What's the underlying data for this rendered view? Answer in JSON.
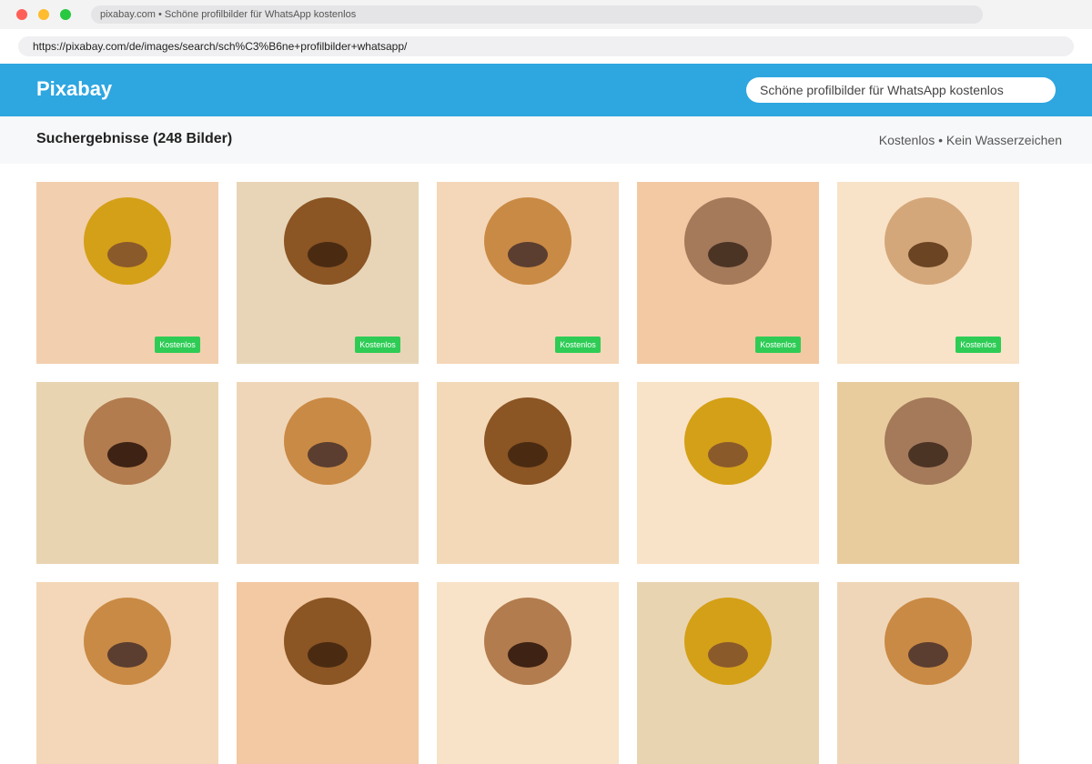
{
  "window": {
    "title": "pixabay.com • Schöne profilbilder für WhatsApp kostenlos",
    "url": "https://pixabay.com/de/images/search/sch%C3%B6ne+profilbilder+whatsapp/"
  },
  "header": {
    "logo": "Pixabay",
    "search_value": "Schöne profilbilder für WhatsApp kostenlos",
    "color": "#2ea6e0"
  },
  "results": {
    "title": "Suchergebnisse (248 Bilder)",
    "meta": "Kostenlos • Kein Wasserzeichen"
  },
  "tiles": [
    {
      "bg": "#f2cfae",
      "face": "#d4a017",
      "mouth": "#8b5a2b",
      "badge": "Kostenlos"
    },
    {
      "bg": "#e8d5b7",
      "face": "#8b5524",
      "mouth": "#4a2b12",
      "badge": "Kostenlos"
    },
    {
      "bg": "#f4d7b8",
      "face": "#c98a45",
      "mouth": "#5b3e30",
      "badge": "Kostenlos"
    },
    {
      "bg": "#f2c9a2",
      "face": "#a47a5b",
      "mouth": "#4c3425",
      "badge": "Kostenlos"
    },
    {
      "bg": "#f8e3c8",
      "face": "#d4a77a",
      "mouth": "#6b4424",
      "badge": "Kostenlos"
    },
    {
      "bg": "#e9d4b2",
      "face": "#b27c4e",
      "mouth": "#3e2214",
      "badge": ""
    },
    {
      "bg": "#f0d6b8",
      "face": "#c98a45",
      "mouth": "#5b3e30",
      "badge": ""
    },
    {
      "bg": "#f3d9b8",
      "face": "#8b5524",
      "mouth": "#4a2b12",
      "badge": ""
    },
    {
      "bg": "#f8e3c8",
      "face": "#d4a017",
      "mouth": "#8b5a2b",
      "badge": ""
    },
    {
      "bg": "#e8cc9e",
      "face": "#a47a5b",
      "mouth": "#4c3425",
      "badge": ""
    },
    {
      "bg": "#f4d7b8",
      "face": "#c98a45",
      "mouth": "#5b3e30",
      "badge": ""
    },
    {
      "bg": "#f2c9a2",
      "face": "#8b5524",
      "mouth": "#4a2b12",
      "badge": ""
    },
    {
      "bg": "#f8e3c8",
      "face": "#b27c4e",
      "mouth": "#3e2214",
      "badge": ""
    },
    {
      "bg": "#e9d4b2",
      "face": "#d4a017",
      "mouth": "#8b5a2b",
      "badge": ""
    },
    {
      "bg": "#f0d6b8",
      "face": "#c98a45",
      "mouth": "#5b3e30",
      "badge": ""
    }
  ]
}
